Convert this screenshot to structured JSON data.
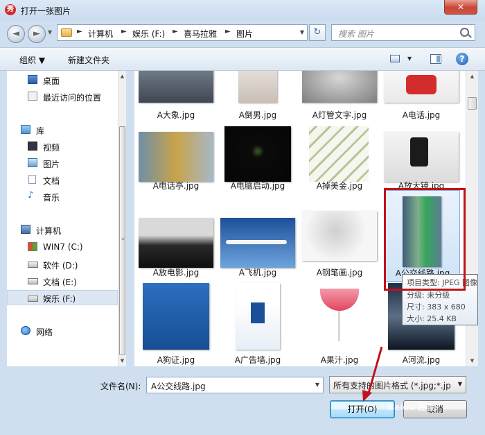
{
  "window": {
    "title": "打开一张图片",
    "app_icon_letter": "秀",
    "close_glyph": "✕"
  },
  "nav": {
    "back_glyph": "◄",
    "forward_glyph": "►"
  },
  "address": {
    "segments": [
      "计算机",
      "娱乐 (F:)",
      "喜马拉雅",
      "图片"
    ],
    "separator": "►"
  },
  "search": {
    "placeholder": "搜索 图片"
  },
  "toolbar": {
    "organize": "组织 ▼",
    "new_folder": "新建文件夹",
    "help": "?"
  },
  "sidebar": {
    "items": [
      {
        "label": "桌面",
        "icon": "desktop-icon"
      },
      {
        "label": "最近访问的位置",
        "icon": "recent-places-icon"
      },
      {
        "label": "库",
        "icon": "library-icon"
      },
      {
        "label": "视频",
        "icon": "video-icon"
      },
      {
        "label": "图片",
        "icon": "pictures-icon"
      },
      {
        "label": "文档",
        "icon": "documents-icon"
      },
      {
        "label": "音乐",
        "icon": "music-icon"
      },
      {
        "label": "计算机",
        "icon": "computer-icon"
      },
      {
        "label": "WIN7 (C:)",
        "icon": "windows-drive-icon"
      },
      {
        "label": "软件 (D:)",
        "icon": "drive-icon"
      },
      {
        "label": "文档 (E:)",
        "icon": "drive-icon"
      },
      {
        "label": "娱乐 (F:)",
        "icon": "drive-icon",
        "selected": true
      },
      {
        "label": "网络",
        "icon": "network-icon"
      }
    ]
  },
  "files": [
    {
      "name": "A大象.jpg"
    },
    {
      "name": "A倒男.jpg"
    },
    {
      "name": "A灯管文字.jpg"
    },
    {
      "name": "A电话.jpg"
    },
    {
      "name": "A电话亭.jpg"
    },
    {
      "name": "A电脑启动.jpg"
    },
    {
      "name": "A掉美金.jpg"
    },
    {
      "name": "A放大镜.jpg"
    },
    {
      "name": "A放电影.jpg"
    },
    {
      "name": "A飞机.jpg"
    },
    {
      "name": "A钢笔画.jpg"
    },
    {
      "name": "A公交线路.jpg",
      "selected": true
    },
    {
      "name": "A狗证.jpg"
    },
    {
      "name": "A广告墙.jpg"
    },
    {
      "name": "A果汁.jpg"
    },
    {
      "name": "A河流.jpg"
    }
  ],
  "tooltip": {
    "type": "项目类型: JPEG 图像",
    "rating": "分级: 未分级",
    "dimensions": "尺寸: 383 x 680",
    "size": "大小: 25.4 KB"
  },
  "footer": {
    "filename_label": "文件名(N):",
    "filename_value": "A公交线路.jpg",
    "filter_value": "所有支持的图片格式 (*.jpg;*.jp",
    "open_button": "打开(O)",
    "cancel_button": "取消",
    "watermark": "Baidu 经验"
  },
  "colors": {
    "highlight_box": "#c1121c",
    "annotation_arrow": "#c1121c",
    "window_frame": "#cfdff0"
  }
}
